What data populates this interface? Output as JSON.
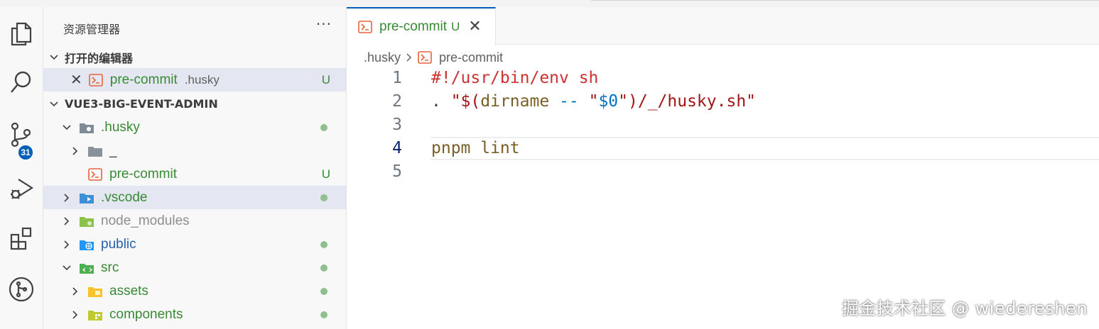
{
  "sidebar": {
    "title": "资源管理器",
    "more": "···",
    "open_editors": {
      "header": "打开的编辑器",
      "file_name": "pre-commit",
      "file_dir": ".husky",
      "status": "U"
    },
    "project": {
      "header": "VUE3-BIG-EVENT-ADMIN",
      "items": [
        {
          "name": ".husky",
          "status": "dot"
        },
        {
          "name": "_"
        },
        {
          "name": "pre-commit",
          "status": "U"
        },
        {
          "name": ".vscode",
          "status": "dot"
        },
        {
          "name": "node_modules"
        },
        {
          "name": "public",
          "status": "dot"
        },
        {
          "name": "src",
          "status": "dot"
        },
        {
          "name": "assets",
          "status": "dot"
        },
        {
          "name": "components",
          "status": "dot"
        }
      ]
    }
  },
  "activity": {
    "scm_badge": "31",
    "icons": [
      "files-icon",
      "search-icon",
      "source-control-icon",
      "run-debug-icon",
      "extensions-icon",
      "git-graph-icon"
    ]
  },
  "editor": {
    "tab": {
      "name": "pre-commit",
      "status": "U"
    },
    "breadcrumb": {
      "folder": ".husky",
      "file": "pre-commit"
    },
    "lines": {
      "n1": "1",
      "n2": "2",
      "n3": "3",
      "n4": "4",
      "n5": "5",
      "l1": "#!/usr/bin/env sh",
      "l2a": ". ",
      "l2b": "\"$(",
      "l2c": "dirname",
      "l2d": " ",
      "l2e": "--",
      "l2f": " \"",
      "l2g": "$0",
      "l2h": "\")/_/husky.sh\"",
      "l4a": "pnpm",
      "l4b": " lint"
    }
  },
  "watermark": "掘金技术社区 @ wiedereshen",
  "colors": {
    "accent": "#005fb8",
    "untracked": "#388a34",
    "shell_icon": "#e8623a"
  }
}
